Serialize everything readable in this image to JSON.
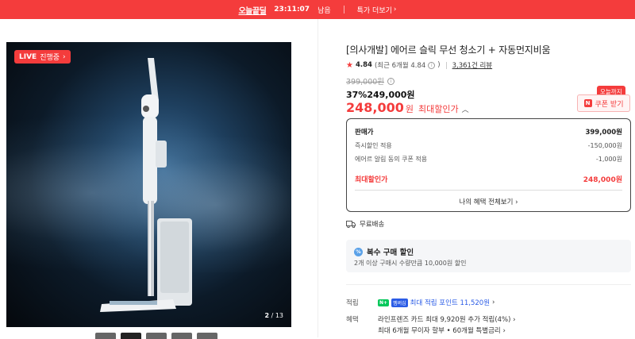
{
  "banner": {
    "logo": "오늘끝딜",
    "timer": "23:11:07",
    "timer_suffix": "남음",
    "more_label": "특가 더보기"
  },
  "gallery": {
    "live_badge_strong": "LIVE",
    "live_badge_text": "진행중",
    "counter_current": "2",
    "counter_total": "/ 13"
  },
  "product": {
    "title": "[의사개발] 에어르 슬릭 무선 청소기 + 자동먼지비움",
    "rating": "4.84",
    "recent_rating": "(최근 6개월 4.84",
    "recent_rating_close": ")",
    "review_count": "3,361건 리뷰",
    "original_price": "399,000원",
    "discount_line": "37%249,000원",
    "final_price": "248,000",
    "final_currency": "원",
    "final_label": "최대할인가"
  },
  "coupon": {
    "badge": "오늘까지",
    "button_label": "쿠폰 받기"
  },
  "price_box": {
    "rows": [
      {
        "label": "판매가",
        "value": "399,000원"
      },
      {
        "label": "즉시할인 적용",
        "value": "-150,000원"
      },
      {
        "label": "에어르 알림 동의 쿠폰 적용",
        "value": "-1,000원"
      },
      {
        "label": "최대할인가",
        "value": "248,000원"
      }
    ],
    "all_benefits": "나의 혜택 전체보기"
  },
  "shipping": "무료배송",
  "multi": {
    "title": "복수 구매 할인",
    "sub": "2개 이상 구매시 수량만큼 10,000원 할인"
  },
  "points": {
    "label": "적립",
    "np_badge": "N+",
    "member_badge": "멤버십",
    "text": "최대 적립 포인트 11,520원"
  },
  "benefits": {
    "label": "혜택",
    "lines": [
      "라인프렌즈 카드 최대 9,920원 추가 적립(4%)",
      "최대 6개월 무이자 할부 • 60개월 특별금리"
    ]
  },
  "colors": {
    "accent": "#f43c3c",
    "link": "#2b5ce6",
    "naver_green": "#03c75a"
  }
}
